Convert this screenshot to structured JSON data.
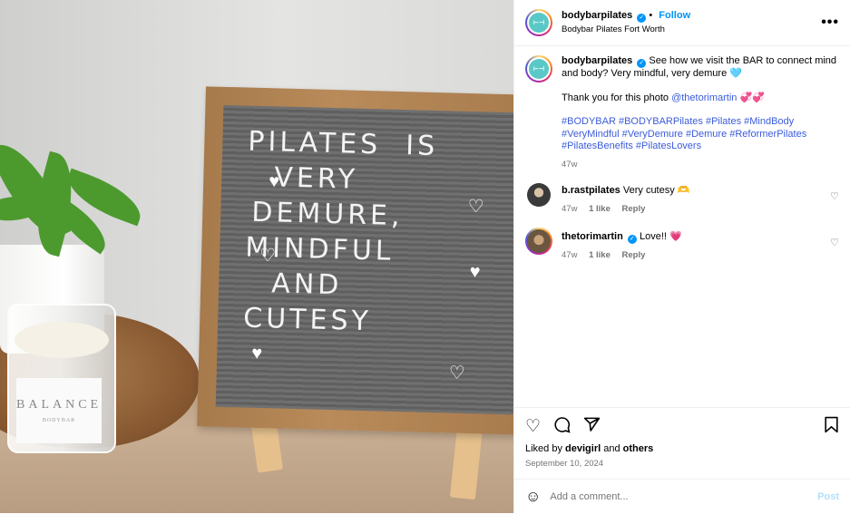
{
  "photo": {
    "board_lines": [
      "PILATES  IS",
      "VERY",
      "DEMURE,",
      "MINDFUL",
      "AND",
      "CUTESY"
    ],
    "candle_label": "BALANCE",
    "candle_brand": "BODYBAR"
  },
  "header": {
    "username": "bodybarpilates",
    "location": "Bodybar Pilates Fort Worth",
    "separator": "•",
    "follow_label": "Follow",
    "more_icon": "•••"
  },
  "caption": {
    "username": "bodybarpilates",
    "text": "See how we visit the BAR to connect mind and body? Very mindful, very demure 🩵",
    "thanks": "Thank you for this photo",
    "mention": "@thetorimartin",
    "thanks_emoji": "💞💞",
    "hashtags_line1": "#BODYBAR #BODYBARPilates #Pilates #MindBody",
    "hashtags_line2": "#VeryMindful #VeryDemure #Demure #ReformerPilates",
    "hashtags_line3": "#PilatesBenefits #PilatesLovers",
    "age": "47w"
  },
  "comments": [
    {
      "username": "b.rastpilates",
      "text": "Very cutesy 🫶",
      "age": "47w",
      "likes": "1 like",
      "reply": "Reply"
    },
    {
      "username": "thetorimartin",
      "text": "Love!! 💗",
      "age": "47w",
      "likes": "1 like",
      "reply": "Reply"
    }
  ],
  "actions": {
    "like_icon": "heart-icon",
    "comment_icon": "comment-icon",
    "share_icon": "share-icon",
    "save_icon": "bookmark-icon"
  },
  "likes": {
    "prefix": "Liked by",
    "user": "devigirl",
    "and": "and",
    "others": "others"
  },
  "date": "September 10, 2024",
  "add_comment": {
    "placeholder": "Add a comment...",
    "post_label": "Post"
  },
  "colors": {
    "accent": "#0095f6",
    "hashtag": "#3b5bdb",
    "muted": "#737373"
  }
}
